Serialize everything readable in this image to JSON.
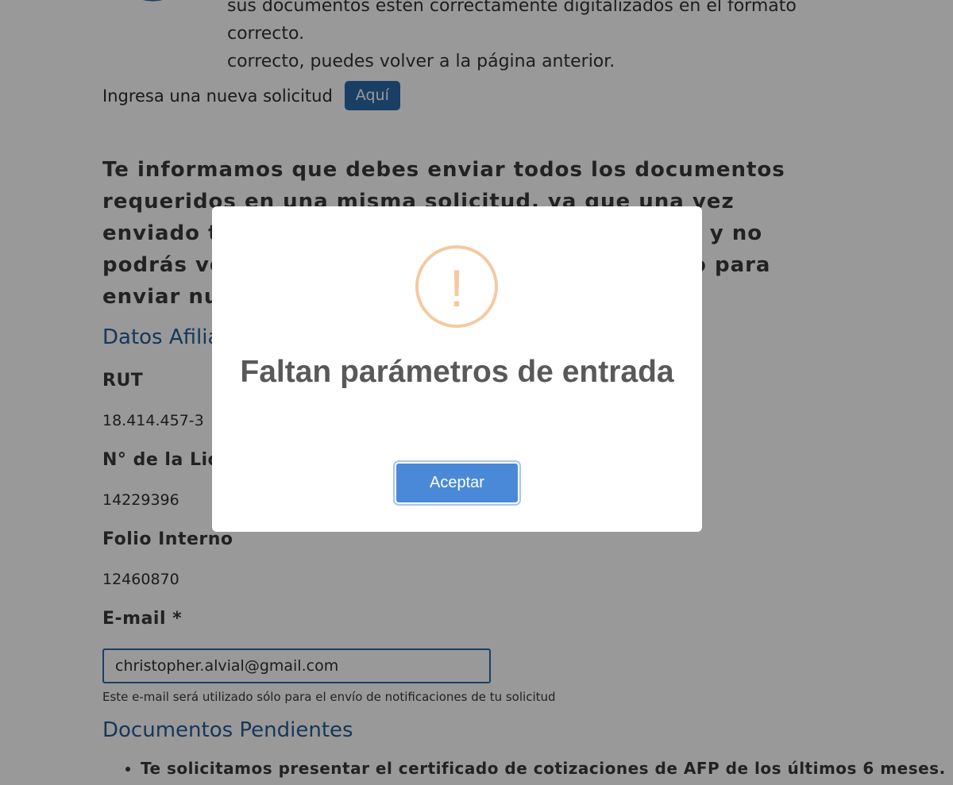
{
  "top": {
    "text_line1": "sus documentos estén correctamente digitalizados en el formato correcto.",
    "text_line2": "correcto, puedes volver a la página anterior."
  },
  "new_request": {
    "label": "Ingresa una nueva solicitud",
    "button": "Aquí"
  },
  "notice": "Te informamos que debes enviar todos los documentos requeridos en una misma solicitud, ya que una vez enviado tu requerimiento, éste quedará cerrado y no podrás volver a ingresar. Hasta que sea resuelto para enviar nuevamente.",
  "afiliado": {
    "title": "Datos Afiliado",
    "rut_label": "RUT",
    "rut_value": "18.414.457-3",
    "licencia_label": "N° de la Licencia",
    "licencia_value": "14229396",
    "folio_label": "Folio Interno",
    "folio_value": "12460870",
    "email_label": "E-mail *",
    "email_value": "christopher.alvial@gmail.com",
    "email_help": "Este e-mail será utilizado sólo para el envío de notificaciones de tu solicitud"
  },
  "documentos": {
    "title": "Documentos Pendientes",
    "items": [
      "Te solicitamos presentar el certificado de cotizaciones de AFP de los últimos 6 meses."
    ]
  },
  "modal": {
    "icon_glyph": "!",
    "icon_name": "warning-icon",
    "icon_color": "#f5c9a0",
    "title": "Faltan parámetros de entrada",
    "accept_button": "Aceptar",
    "accept_color": "#4a89d7"
  },
  "colors": {
    "brand_blue": "#2a6aa7",
    "section_title": "#255d93"
  }
}
